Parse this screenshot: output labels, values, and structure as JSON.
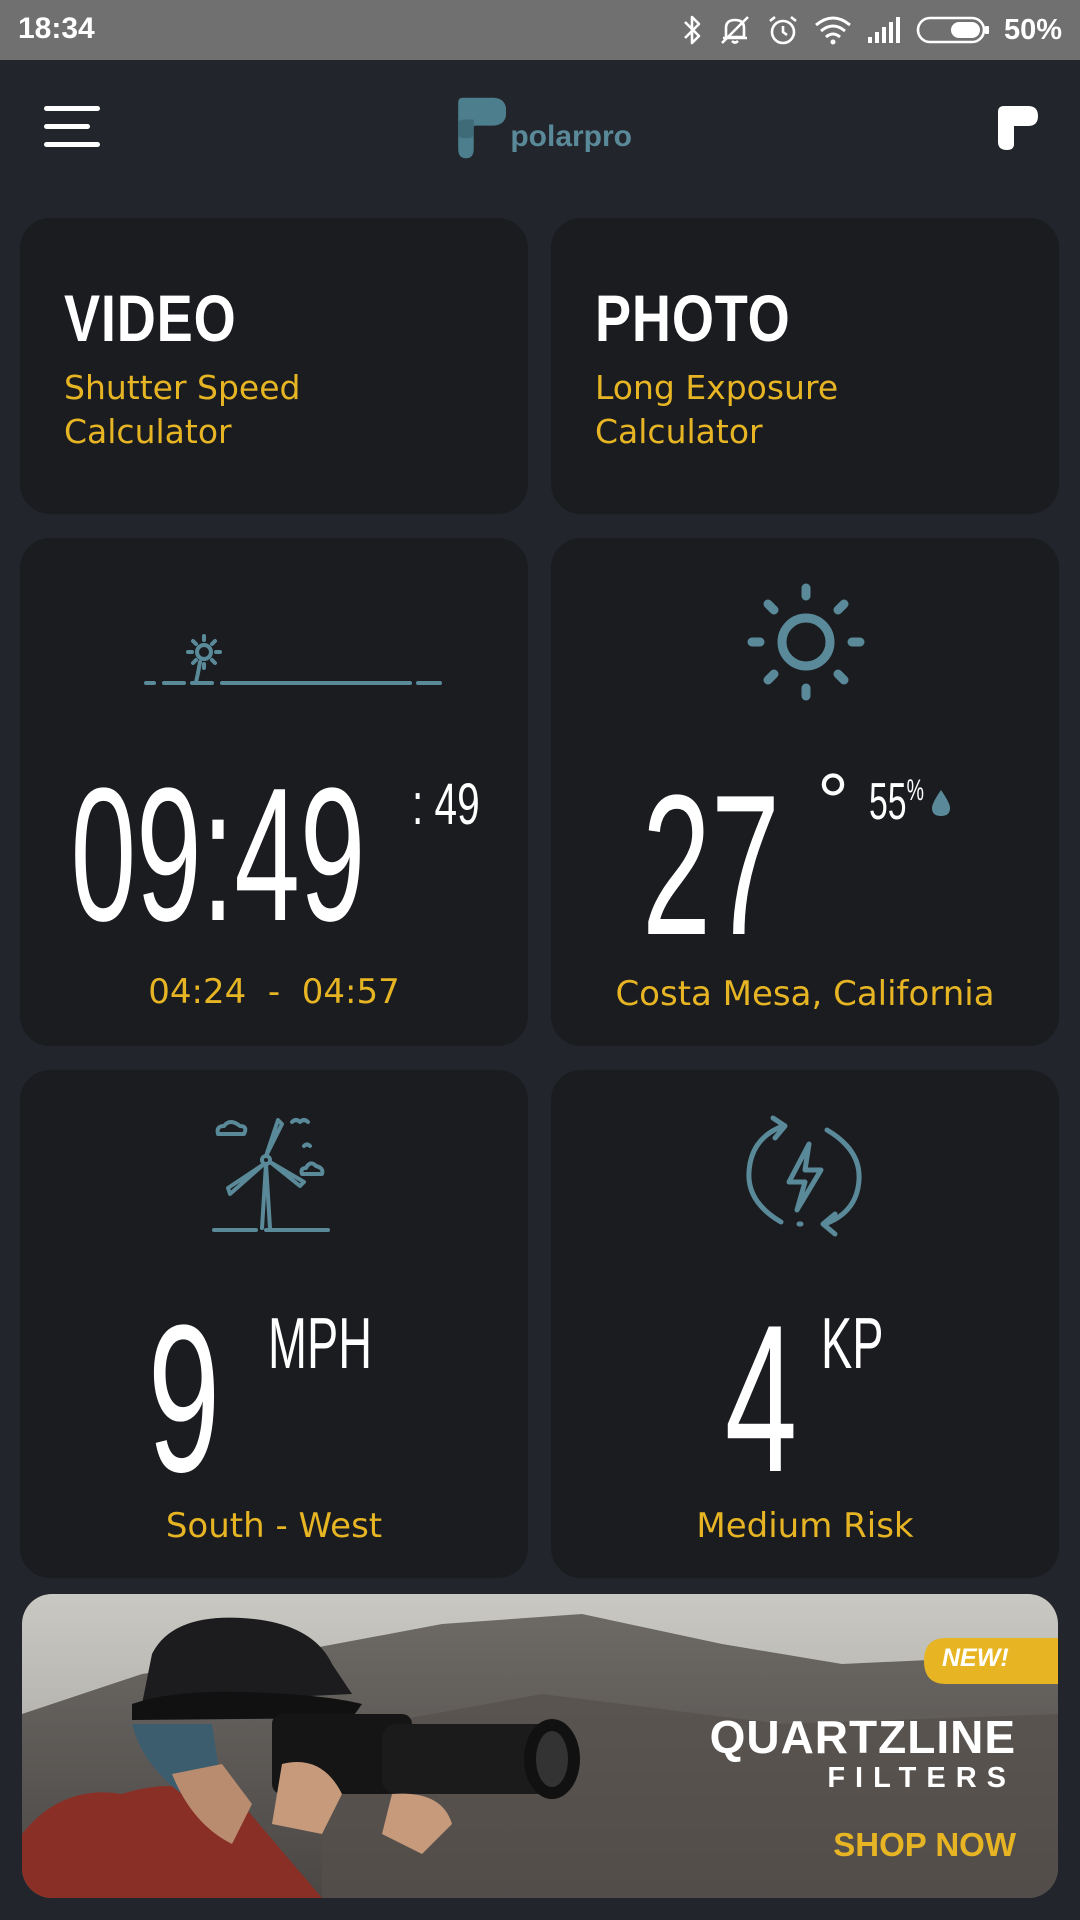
{
  "status_bar": {
    "time": "18:34",
    "battery_percent": "50%",
    "icons": [
      "bluetooth-icon",
      "mute-icon",
      "alarm-icon",
      "wifi-icon",
      "signal-icon",
      "battery-icon"
    ]
  },
  "header": {
    "logo_text": "polarpro",
    "menu_icon": "menu-icon",
    "app_icon": "polarpro-app-icon"
  },
  "colors": {
    "background": "#22252b",
    "card": "#1a1c20",
    "accent_gold": "#e7b523",
    "icon_teal": "#5a8a99"
  },
  "cards": {
    "video": {
      "title": "VIDEO",
      "subtitle_line1": "Shutter Speed",
      "subtitle_line2": "Calculator"
    },
    "photo": {
      "title": "PHOTO",
      "subtitle_line1": "Long Exposure",
      "subtitle_line2": "Calculator"
    },
    "time": {
      "main": "09:49",
      "seconds": ": 49",
      "range": "04:24  -  04:57",
      "icon": "sunrise-horizon-icon"
    },
    "weather": {
      "temperature": "27",
      "degree": "°",
      "humidity": "55",
      "humidity_unit": "%",
      "location": "Costa Mesa, California",
      "icon": "sun-icon"
    },
    "wind": {
      "speed": "9",
      "unit": "MPH",
      "direction": "South - West",
      "icon": "wind-turbine-icon"
    },
    "kp": {
      "value": "4",
      "unit": "KP",
      "risk": "Medium Risk",
      "icon": "lightning-refresh-icon"
    }
  },
  "banner": {
    "badge": "NEW!",
    "title": "QUARTZLINE",
    "subtitle": "FILTERS",
    "cta": "SHOP NOW"
  }
}
